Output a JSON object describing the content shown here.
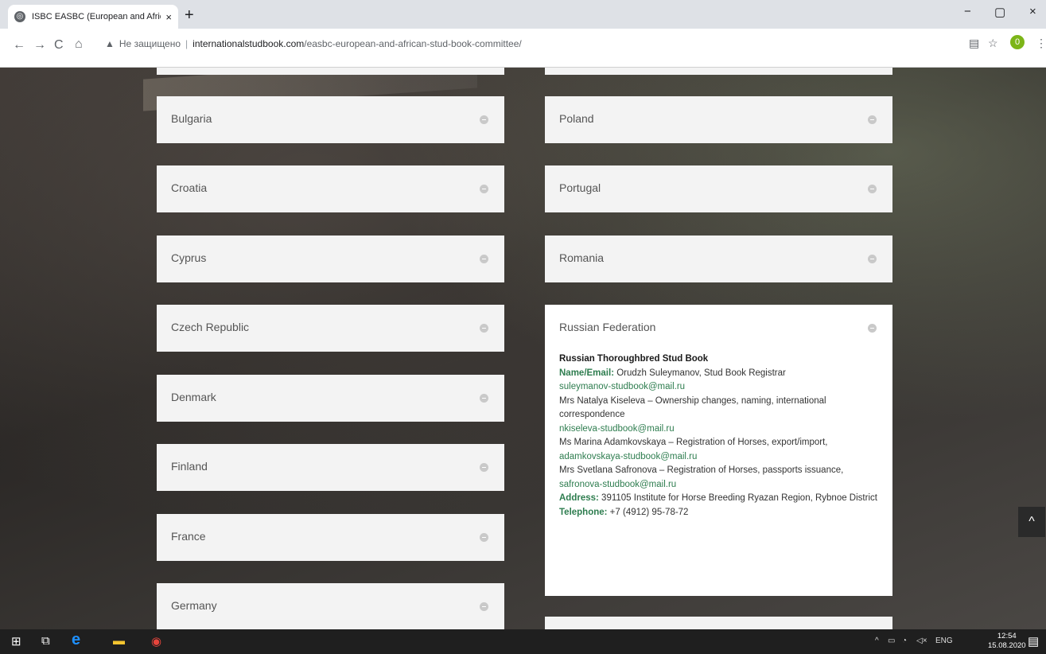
{
  "browser": {
    "tab_title": "ISBC EASBC (European and Afric",
    "tab_close": "×",
    "new_tab": "+",
    "nav_back": "←",
    "nav_forward": "→",
    "nav_reload": "C",
    "nav_home": "⌂",
    "security_warning": "▲",
    "security_label": "Не защищено",
    "url_domain": "internationalstudbook.com",
    "url_path": "/easbc-european-and-african-stud-book-committee/",
    "profile_initial": "0",
    "win_minimize": "−",
    "win_maximize": "▢",
    "win_close": "×"
  },
  "left_column": [
    {
      "label": "Bulgaria"
    },
    {
      "label": "Croatia"
    },
    {
      "label": "Cyprus"
    },
    {
      "label": "Czech Republic"
    },
    {
      "label": "Denmark"
    },
    {
      "label": "Finland"
    },
    {
      "label": "France"
    },
    {
      "label": "Germany"
    }
  ],
  "right_column": [
    {
      "label": "Poland"
    },
    {
      "label": "Portugal"
    },
    {
      "label": "Romania"
    }
  ],
  "russia": {
    "label": "Russian Federation",
    "heading": "Russian Thoroughbred Stud Book",
    "name_key": "Name/Email:",
    "name_value": " Orudzh Suleymanov, Stud Book Registrar",
    "email1": "suleymanov-studbook@mail.ru",
    "person2": "Mrs Natalya Kiseleva – Ownership changes, naming, international correspondence",
    "email2": "nkiseleva-studbook@mail.ru",
    "person3": "Ms Marina Adamkovskaya – Registration of Horses, export/import,",
    "email3": "adamkovskaya-studbook@mail.ru",
    "person4": "Mrs Svetlana Safronova – Registration of Horses, passports issuance,",
    "email4": "safronova-studbook@mail.ru",
    "address_key": "Address:",
    "address_value": " 391105 Institute for Horse Breeding Ryazan Region, Rybnoe District",
    "phone_key": "Telephone:",
    "phone_value": " +7 (4912) 95-78-72"
  },
  "scroll_top_label": "^",
  "taskbar": {
    "tray_lang": "ENG",
    "time": "12:54",
    "date": "15.08.2020"
  }
}
